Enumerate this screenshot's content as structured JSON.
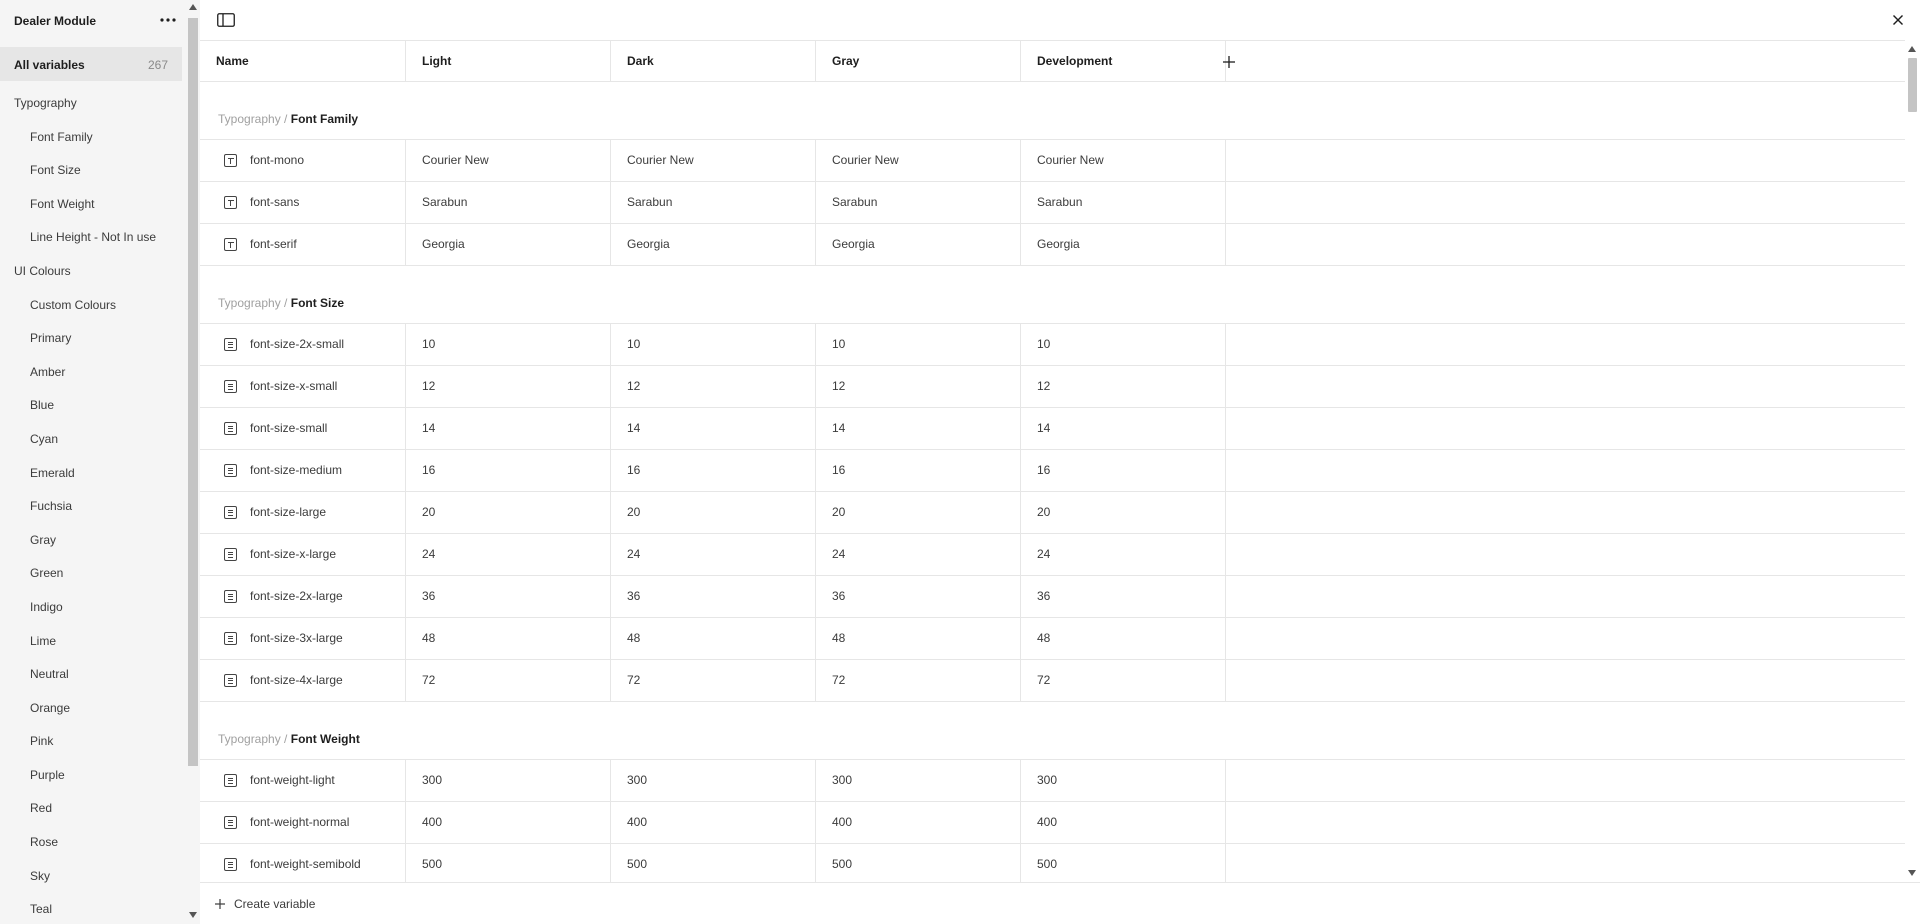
{
  "sidebar": {
    "title": "Dealer Module",
    "more_icon": "more-horizontal-icon",
    "all_variables": {
      "label": "All variables",
      "count": "267"
    },
    "items": [
      {
        "label": "Typography",
        "kind": "group"
      },
      {
        "label": "Font Family",
        "kind": "child"
      },
      {
        "label": "Font Size",
        "kind": "child"
      },
      {
        "label": "Font Weight",
        "kind": "child"
      },
      {
        "label": "Line Height - Not In use",
        "kind": "child"
      },
      {
        "label": "UI Colours",
        "kind": "group"
      },
      {
        "label": "Custom Colours",
        "kind": "child"
      },
      {
        "label": "Primary",
        "kind": "child"
      },
      {
        "label": "Amber",
        "kind": "child"
      },
      {
        "label": "Blue",
        "kind": "child"
      },
      {
        "label": "Cyan",
        "kind": "child"
      },
      {
        "label": "Emerald",
        "kind": "child"
      },
      {
        "label": "Fuchsia",
        "kind": "child"
      },
      {
        "label": "Gray",
        "kind": "child"
      },
      {
        "label": "Green",
        "kind": "child"
      },
      {
        "label": "Indigo",
        "kind": "child"
      },
      {
        "label": "Lime",
        "kind": "child"
      },
      {
        "label": "Neutral",
        "kind": "child"
      },
      {
        "label": "Orange",
        "kind": "child"
      },
      {
        "label": "Pink",
        "kind": "child"
      },
      {
        "label": "Purple",
        "kind": "child"
      },
      {
        "label": "Red",
        "kind": "child"
      },
      {
        "label": "Rose",
        "kind": "child"
      },
      {
        "label": "Sky",
        "kind": "child"
      },
      {
        "label": "Teal",
        "kind": "child"
      }
    ]
  },
  "table": {
    "columns": [
      "Name",
      "Light",
      "Dark",
      "Gray",
      "Development"
    ],
    "add_column_icon": "plus-icon",
    "groups": [
      {
        "path": "Typography",
        "name": "Font Family",
        "icon": "text-variable-icon",
        "rows": [
          {
            "name": "font-mono",
            "values": [
              "Courier New",
              "Courier New",
              "Courier New",
              "Courier New"
            ]
          },
          {
            "name": "font-sans",
            "values": [
              "Sarabun",
              "Sarabun",
              "Sarabun",
              "Sarabun"
            ]
          },
          {
            "name": "font-serif",
            "values": [
              "Georgia",
              "Georgia",
              "Georgia",
              "Georgia"
            ]
          }
        ]
      },
      {
        "path": "Typography",
        "name": "Font Size",
        "icon": "number-variable-icon",
        "rows": [
          {
            "name": "font-size-2x-small",
            "values": [
              "10",
              "10",
              "10",
              "10"
            ]
          },
          {
            "name": "font-size-x-small",
            "values": [
              "12",
              "12",
              "12",
              "12"
            ]
          },
          {
            "name": "font-size-small",
            "values": [
              "14",
              "14",
              "14",
              "14"
            ]
          },
          {
            "name": "font-size-medium",
            "values": [
              "16",
              "16",
              "16",
              "16"
            ]
          },
          {
            "name": "font-size-large",
            "values": [
              "20",
              "20",
              "20",
              "20"
            ]
          },
          {
            "name": "font-size-x-large",
            "values": [
              "24",
              "24",
              "24",
              "24"
            ]
          },
          {
            "name": "font-size-2x-large",
            "values": [
              "36",
              "36",
              "36",
              "36"
            ]
          },
          {
            "name": "font-size-3x-large",
            "values": [
              "48",
              "48",
              "48",
              "48"
            ]
          },
          {
            "name": "font-size-4x-large",
            "values": [
              "72",
              "72",
              "72",
              "72"
            ]
          }
        ]
      },
      {
        "path": "Typography",
        "name": "Font Weight",
        "icon": "number-variable-icon",
        "rows": [
          {
            "name": "font-weight-light",
            "values": [
              "300",
              "300",
              "300",
              "300"
            ]
          },
          {
            "name": "font-weight-normal",
            "values": [
              "400",
              "400",
              "400",
              "400"
            ]
          },
          {
            "name": "font-weight-semibold",
            "values": [
              "500",
              "500",
              "500",
              "500"
            ]
          }
        ]
      }
    ]
  },
  "footer": {
    "create_label": "Create variable",
    "icon": "plus-icon"
  },
  "colors": {
    "sidebar_bg": "#f5f5f5",
    "selected_bg": "#e6e6e6",
    "border": "#e6e6e6",
    "muted": "#a0a0a0"
  }
}
